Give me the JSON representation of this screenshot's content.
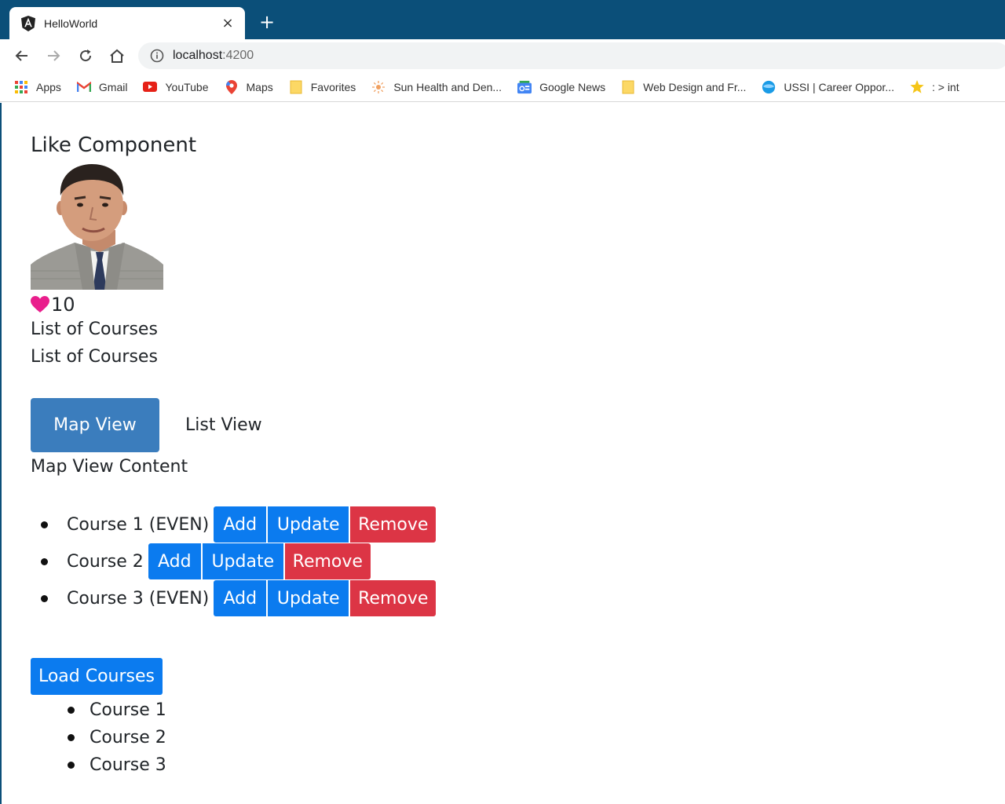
{
  "browser": {
    "tab_title": "HelloWorld",
    "new_tab": "+",
    "close": "×",
    "url_host": "localhost",
    "url_port": ":4200",
    "bookmarks": [
      {
        "label": "Apps",
        "icon": "apps-grid-icon"
      },
      {
        "label": "Gmail",
        "icon": "gmail-icon"
      },
      {
        "label": "YouTube",
        "icon": "youtube-icon"
      },
      {
        "label": "Maps",
        "icon": "maps-pin-icon"
      },
      {
        "label": "Favorites",
        "icon": "folder-icon"
      },
      {
        "label": "Sun Health and Den...",
        "icon": "sun-icon"
      },
      {
        "label": "Google News",
        "icon": "google-news-icon"
      },
      {
        "label": "Web Design and Fr...",
        "icon": "folder-icon"
      },
      {
        "label": "USSI | Career Oppor...",
        "icon": "globe-icon"
      },
      {
        "label": ": > int",
        "icon": "star-icon"
      }
    ]
  },
  "page": {
    "heading": "Like Component",
    "like_count": "10",
    "lines": [
      "List of Courses",
      "List of Courses"
    ],
    "tabs": {
      "map": "Map View",
      "list": "List View"
    },
    "tab_content": "Map View Content",
    "courses": [
      {
        "label": "Course 1 (EVEN)",
        "add": "Add",
        "update": "Update",
        "remove": "Remove"
      },
      {
        "label": "Course 2",
        "add": "Add",
        "update": "Update",
        "remove": "Remove"
      },
      {
        "label": "Course 3 (EVEN)",
        "add": "Add",
        "update": "Update",
        "remove": "Remove"
      }
    ],
    "load_button": "Load Courses",
    "loaded_courses": [
      "Course 1",
      "Course 2",
      "Course 3"
    ]
  },
  "colors": {
    "chrome": "#0b4f79",
    "primary": "#0b7bef",
    "danger": "#dc3545",
    "tab_active": "#3b7dbd",
    "heart": "#e91e8c"
  }
}
